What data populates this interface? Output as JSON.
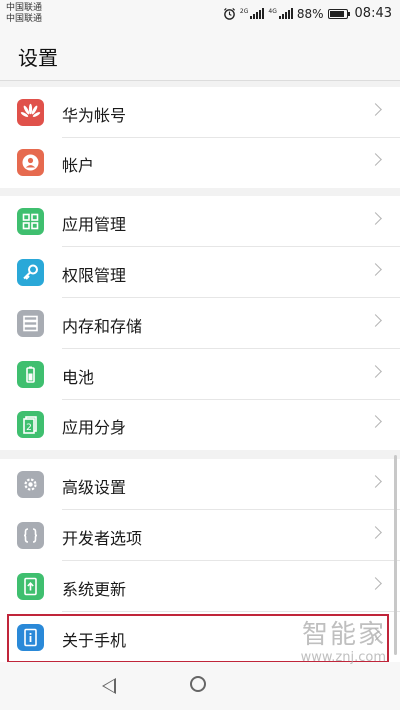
{
  "status_bar": {
    "carrier1": "中国联通",
    "carrier2": "中国联通",
    "network1": "2G",
    "network2": "4G",
    "battery": "88%",
    "battery_level": 0.88,
    "time": "08:43"
  },
  "header": {
    "title": "设置"
  },
  "groups": [
    {
      "items": [
        {
          "name": "huawei-account",
          "label": "华为帐号",
          "icon": "huawei-logo-icon",
          "color": "#e0514a"
        },
        {
          "name": "accounts",
          "label": "帐户",
          "icon": "user-icon",
          "color": "#e66a4f"
        }
      ]
    },
    {
      "items": [
        {
          "name": "app-management",
          "label": "应用管理",
          "icon": "apps-grid-icon",
          "color": "#3fbf6f"
        },
        {
          "name": "permission-management",
          "label": "权限管理",
          "icon": "key-icon",
          "color": "#2aa8d8"
        },
        {
          "name": "memory-storage",
          "label": "内存和存储",
          "icon": "storage-icon",
          "color": "#a8acb3"
        },
        {
          "name": "battery",
          "label": "电池",
          "icon": "battery-icon",
          "color": "#3fbf6f"
        },
        {
          "name": "app-twin",
          "label": "应用分身",
          "icon": "app-twin-icon",
          "color": "#3fbf6f"
        }
      ]
    },
    {
      "items": [
        {
          "name": "advanced-settings",
          "label": "高级设置",
          "icon": "gear-icon",
          "color": "#a8acb3"
        },
        {
          "name": "developer-options",
          "label": "开发者选项",
          "icon": "braces-icon",
          "color": "#a8acb3"
        },
        {
          "name": "system-update",
          "label": "系统更新",
          "icon": "update-icon",
          "color": "#3fbf6f"
        },
        {
          "name": "about-phone",
          "label": "关于手机",
          "icon": "phone-info-icon",
          "color": "#2a89d8"
        }
      ]
    }
  ],
  "watermark": {
    "logo": "智能家",
    "url": "www.znj.com"
  }
}
